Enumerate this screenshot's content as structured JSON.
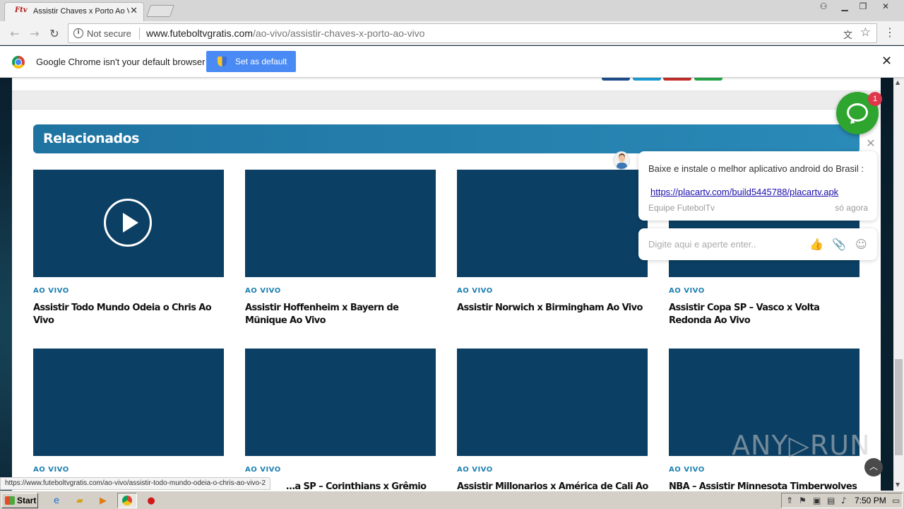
{
  "browser": {
    "tab_title": "Assistir Chaves x Porto Ao V",
    "tab_favicon": "Ftv",
    "security_label": "Not secure",
    "url_domain": "www.futeboltvgratis.com",
    "url_path": "/ao-vivo/assistir-chaves-x-porto-ao-vivo"
  },
  "infobar": {
    "message": "Google Chrome isn't your default browser",
    "button_label": "Set as default"
  },
  "page": {
    "section_title": "Relacionados",
    "share_colors": [
      "#1e4f8f",
      "#1d9ed8",
      "#c5302b",
      "#27a84a"
    ],
    "cards": [
      {
        "category": "AO VIVO",
        "title": "Assistir Todo Mundo Odeia o Chris Ao Vivo"
      },
      {
        "category": "AO VIVO",
        "title": "Assistir Hoffenheim x Bayern de Münique Ao Vivo"
      },
      {
        "category": "AO VIVO",
        "title": "Assistir Norwich x Birmingham Ao Vivo"
      },
      {
        "category": "AO VIVO",
        "title": "Assistir Copa SP – Vasco x Volta Redonda Ao Vivo"
      },
      {
        "category": "AO VIVO",
        "title": ""
      },
      {
        "category": "AO VIVO",
        "title": "…a SP – Corinthians x Grêmio"
      },
      {
        "category": "AO VIVO",
        "title": "Assistir Millonarios x América de Cali Ao"
      },
      {
        "category": "AO VIVO",
        "title": "NBA – Assistir Minnesota Timberwolves"
      }
    ]
  },
  "chat": {
    "badge_count": "1",
    "message": "Baixe e instale o melhor aplicativo android do Brasil :",
    "link": "https://placartv.com/build5445788/placartv.apk",
    "author": "Equipe FutebolTv",
    "time": "só agora",
    "input_placeholder": "Digite aqui e aperte enter.."
  },
  "status_bar_url": "https://www.futeboltvgratis.com/ao-vivo/assistir-todo-mundo-odeia-o-chris-ao-vivo-2",
  "watermark": "ANY▷RUN",
  "taskbar": {
    "start_label": "Start",
    "clock": "7:50 PM"
  }
}
